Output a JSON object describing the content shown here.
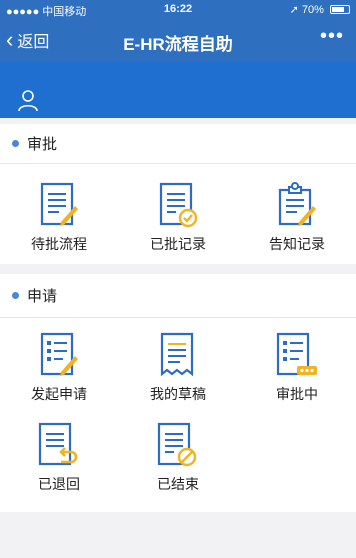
{
  "status_bar": {
    "carrier": "●●●●● 中国移动",
    "time": "16:22",
    "battery": "70%"
  },
  "nav": {
    "back_label": "返回",
    "title": "E-HR流程自助",
    "more_label": "•••"
  },
  "approval": {
    "title": "审批",
    "items": [
      {
        "label": "待批流程",
        "icon": "pending-approval-icon"
      },
      {
        "label": "已批记录",
        "icon": "approved-records-icon"
      },
      {
        "label": "告知记录",
        "icon": "notification-records-icon"
      }
    ]
  },
  "apply": {
    "title": "申请",
    "items": [
      {
        "label": "发起申请",
        "icon": "new-application-icon"
      },
      {
        "label": "我的草稿",
        "icon": "drafts-icon"
      },
      {
        "label": "审批中",
        "icon": "in-approval-icon"
      },
      {
        "label": "已退回",
        "icon": "returned-icon"
      },
      {
        "label": "已结束",
        "icon": "finished-icon"
      }
    ]
  },
  "colors": {
    "nav_blue": "#2f6fc0",
    "banner_blue": "#1f6fd1",
    "icon_blue": "#2d6bc4",
    "icon_yellow": "#f0b323"
  }
}
